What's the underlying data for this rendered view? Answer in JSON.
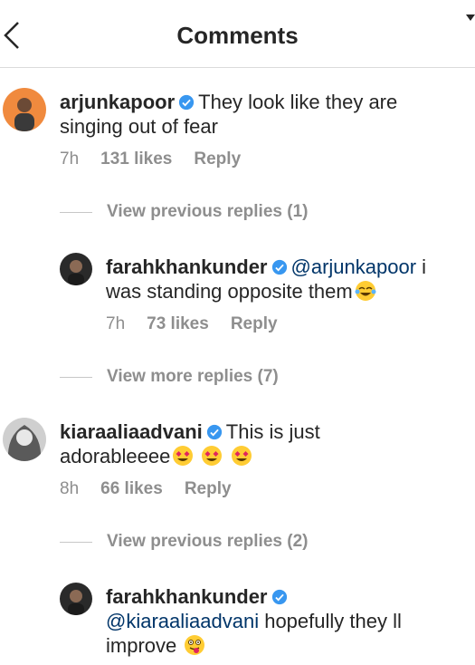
{
  "header": {
    "title": "Comments"
  },
  "threads": [
    {
      "user": "arjunkapoor",
      "text_line1": "They look like they are",
      "text_line2": "singing out of fear",
      "time": "7h",
      "likes": "131 likes",
      "reply": "Reply",
      "view_label": "View previous replies (1)",
      "reply_item": {
        "user": "farahkhankunder",
        "mention": "@arjunkapoor",
        "text_tail": " i",
        "text_line2": "was standing opposite them",
        "emoji": "face-with-tears-of-joy",
        "time": "7h",
        "likes": "73 likes",
        "reply": "Reply"
      },
      "more_label": "View more replies (7)"
    },
    {
      "user": "kiaraaliaadvani",
      "text_line1": "This is just",
      "text_line2": "adorableeee",
      "emojis": [
        "heart-eyes",
        "heart-eyes",
        "heart-eyes"
      ],
      "time": "8h",
      "likes": "66 likes",
      "reply": "Reply",
      "view_label": "View previous replies (2)",
      "reply_item": {
        "user": "farahkhankunder",
        "mention": "@kiaraaliaadvani",
        "text_tail": " hopefully they ll",
        "text_line2": "improve",
        "emoji": "winking-face-with-tongue"
      }
    }
  ],
  "colors": {
    "link": "#003569",
    "muted": "#8e8e8e",
    "verified": "#3897f0"
  }
}
